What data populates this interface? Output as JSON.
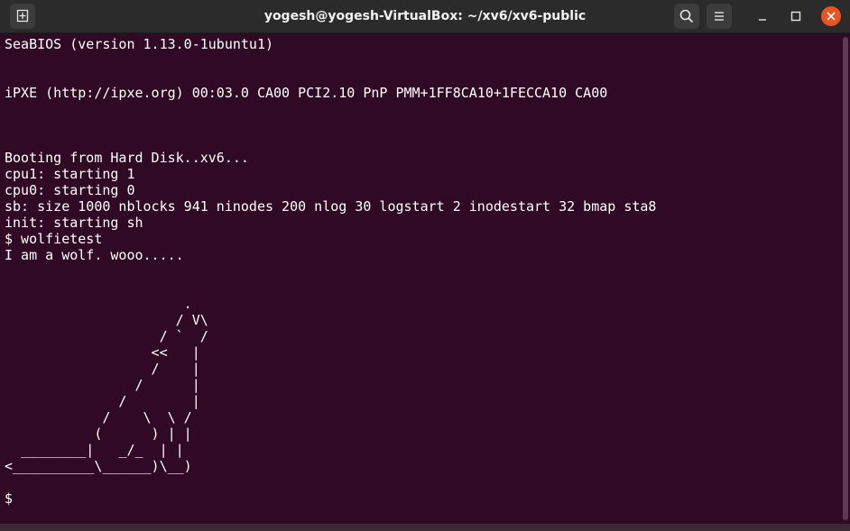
{
  "window": {
    "title": "yogesh@yogesh-VirtualBox: ~/xv6/xv6-public"
  },
  "icons": {
    "new_tab": "new-tab-icon",
    "search": "search-icon",
    "menu": "hamburger-menu-icon",
    "minimize": "minimize-icon",
    "maximize": "maximize-icon",
    "close": "close-icon"
  },
  "colors": {
    "terminal_bg": "#300a24",
    "titlebar_bg": "#2b2b2b",
    "close_orange": "#e95420",
    "text": "#ffffff"
  },
  "terminal": {
    "lines": [
      "SeaBIOS (version 1.13.0-1ubuntu1)",
      "",
      "",
      "iPXE (http://ipxe.org) 00:03.0 CA00 PCI2.10 PnP PMM+1FF8CA10+1FECCA10 CA00",
      "",
      "",
      "",
      "Booting from Hard Disk..xv6...",
      "cpu1: starting 1",
      "cpu0: starting 0",
      "sb: size 1000 nblocks 941 ninodes 200 nlog 30 logstart 2 inodestart 32 bmap sta8",
      "init: starting sh",
      "$ wolfietest",
      "I am a wolf. wooo.....",
      "",
      "",
      "                      .",
      "                     / V\\",
      "                   / `  /",
      "                  <<   |",
      "                  /    |",
      "                /      |",
      "              /        |",
      "            /    \\  \\ /",
      "           (      ) | |",
      "  ________|   _/_  | |",
      "<__________\\______)\\__)",
      "",
      "$"
    ]
  }
}
